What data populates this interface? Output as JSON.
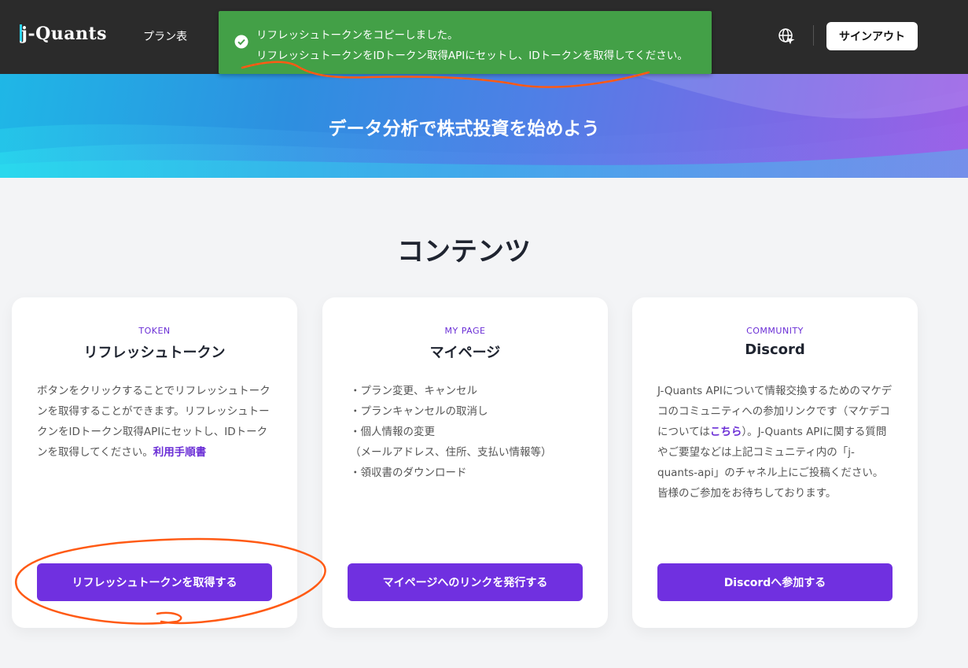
{
  "header": {
    "logo_text": "j-Quants",
    "nav_plan": "プラン表",
    "signout_label": "サインアウト"
  },
  "toast": {
    "line1": "リフレッシュトークンをコピーしました。",
    "line2": "リフレッシュトークンをIDトークン取得APIにセットし、IDトークンを取得してください。",
    "color": "#43a047"
  },
  "hero": {
    "title": "データ分析で株式投資を始めよう"
  },
  "section": {
    "title": "コンテンツ"
  },
  "cards": [
    {
      "tag": "TOKEN",
      "title": "リフレッシュトークン",
      "body": "ボタンをクリックすることでリフレッシュトークンを取得することができます。リフレッシュトークンをIDトークン取得APIにセットし、IDトークンを取得してください。",
      "link": "利用手順書",
      "button": "リフレッシュトークンを取得する"
    },
    {
      "tag": "MY PAGE",
      "title": "マイページ",
      "items": [
        "・プラン変更、キャンセル",
        "・プランキャンセルの取消し",
        "・個人情報の変更",
        "（メールアドレス、住所、支払い情報等）",
        "・領収書のダウンロード"
      ],
      "button": "マイページへのリンクを発行する"
    },
    {
      "tag": "COMMUNITY",
      "title": "Discord",
      "body_before": "J-Quants APIについて情報交換するためのマケデコのコミュニティへの参加リンクです（マケデコについては",
      "body_link": "こちら",
      "body_after": "）。J-Quants APIに関する質問やご要望などは上記コミュニティ内の「j-quants-api」のチャネル上にご投稿ください。皆様のご参加をお待ちしております。",
      "button": "Discordへ参加する"
    }
  ],
  "colors": {
    "header_bg": "#2b2b2b",
    "accent": "#7030e0",
    "annotation": "#ff5a14"
  },
  "icons": [
    "check-circle-icon",
    "globe-icon"
  ]
}
